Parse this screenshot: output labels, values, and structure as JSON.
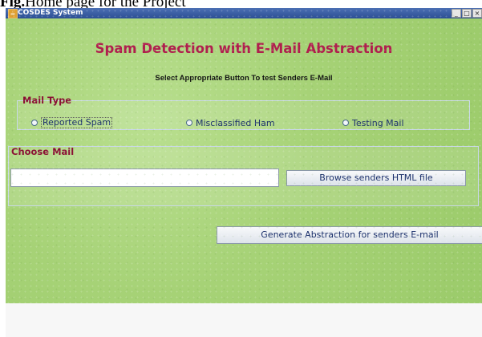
{
  "caption": {
    "prefix": "Fig.",
    "text": "Home page for  the Project"
  },
  "window": {
    "title": "COSDES System",
    "controls": {
      "minimize": "_",
      "maximize": "□",
      "close": "×"
    }
  },
  "header": {
    "title": "Spam Detection with E-Mail Abstraction",
    "subtitle": "Select Appropriate Button To test Senders E-Mail"
  },
  "mail_type": {
    "legend": "Mail Type",
    "options": [
      {
        "label": "Reported Spam",
        "selected": false
      },
      {
        "label": "Misclassified Ham",
        "selected": false
      },
      {
        "label": "Testing Mail",
        "selected": false
      }
    ]
  },
  "choose_mail": {
    "legend": "Choose Mail",
    "file_value": "",
    "browse_label": "Browse senders HTML file"
  },
  "actions": {
    "generate_label": "Generate Abstraction for senders E-mail"
  },
  "colors": {
    "accent": "#b01f4e",
    "titlebar": "#3b5fa8",
    "background": "#a6d276"
  },
  "icons": {
    "app": "java-cup-icon"
  }
}
